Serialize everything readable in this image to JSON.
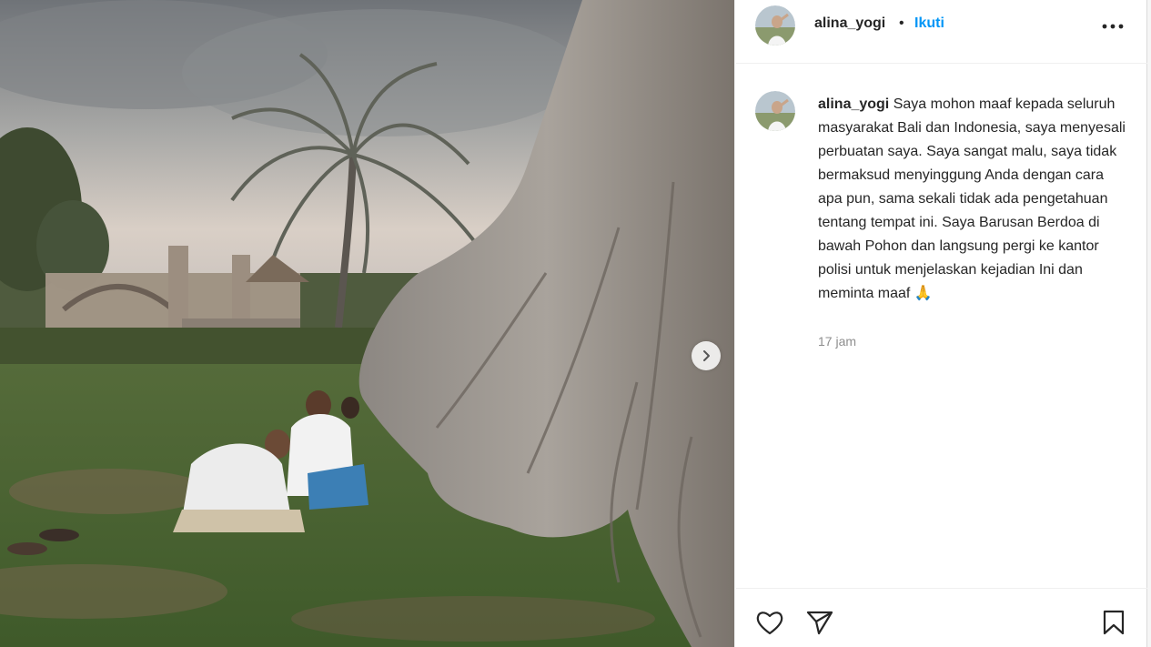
{
  "post": {
    "username": "alina_yogi",
    "dot": "•",
    "follow_label": "Ikuti",
    "caption_user": "alina_yogi",
    "caption_text": " Saya mohon maaf kepada seluruh masyarakat Bali dan Indonesia, saya menyesali perbuatan saya. Saya sangat malu, saya tidak bermaksud menyinggung Anda dengan cara apa pun, sama sekali tidak ada pengetahuan tentang tempat ini. Saya Barusan Berdoa di bawah Pohon dan langsung pergi ke kantor polisi untuk menjelaskan kejadian Ini dan meminta maaf 🙏",
    "timestamp": "17 jam"
  },
  "icons": {
    "more": "more-options-icon",
    "next": "chevron-right-icon",
    "like": "heart-icon",
    "share": "paper-plane-icon",
    "save": "bookmark-icon"
  },
  "colors": {
    "accent": "#0095f6",
    "text": "#262626",
    "muted": "#8e8e8e"
  }
}
